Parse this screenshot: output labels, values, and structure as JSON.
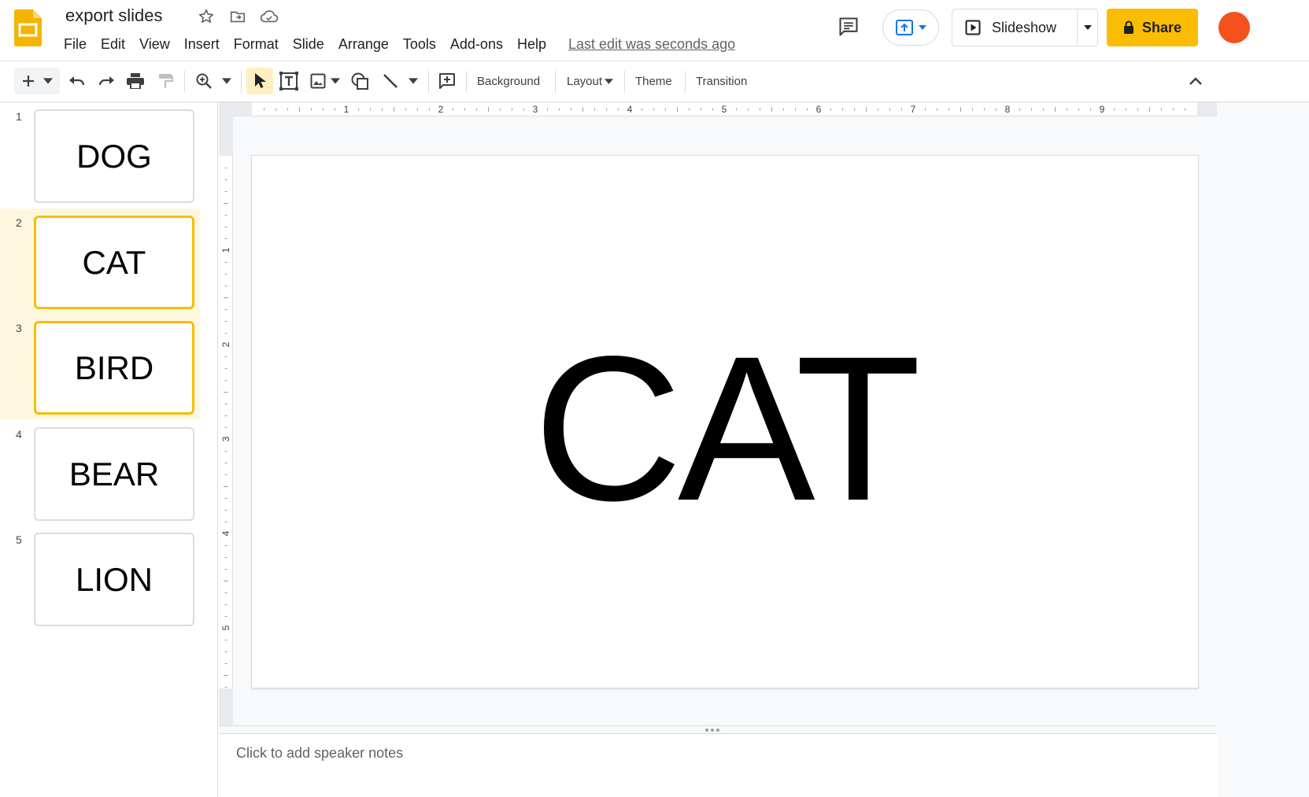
{
  "doc": {
    "title": "export slides",
    "last_edit": "Last edit was seconds ago"
  },
  "menu": [
    "File",
    "Edit",
    "View",
    "Insert",
    "Format",
    "Slide",
    "Arrange",
    "Tools",
    "Add-ons",
    "Help"
  ],
  "header_buttons": {
    "slideshow": "Slideshow",
    "share": "Share"
  },
  "toolbar": {
    "background": "Background",
    "layout": "Layout",
    "theme": "Theme",
    "transition": "Transition"
  },
  "ruler": {
    "horizontal_labels": [
      "1",
      "2",
      "3",
      "4",
      "5",
      "6",
      "7",
      "8",
      "9"
    ],
    "vertical_labels": [
      "1",
      "2",
      "3",
      "4",
      "5"
    ]
  },
  "slides": [
    {
      "number": "1",
      "text": "DOG",
      "selected": false
    },
    {
      "number": "2",
      "text": "CAT",
      "selected": true
    },
    {
      "number": "3",
      "text": "BIRD",
      "selected": true
    },
    {
      "number": "4",
      "text": "BEAR",
      "selected": false
    },
    {
      "number": "5",
      "text": "LION",
      "selected": false
    }
  ],
  "current_slide": {
    "text": "CAT"
  },
  "notes": {
    "placeholder": "Click to add speaker notes"
  },
  "colors": {
    "accent": "#fbbc04",
    "selection_bg": "#fef7e0",
    "logo": "#f4b400",
    "present_blue": "#1a73e8",
    "avatar": "#f4511e"
  },
  "icons": {
    "title": [
      "star-icon",
      "move-to-folder-icon",
      "cloud-saved-icon"
    ],
    "header": [
      "comment-icon",
      "present-icon",
      "slideshow-play-icon",
      "lock-icon"
    ],
    "toolbar": [
      "plus-icon",
      "undo-icon",
      "redo-icon",
      "print-icon",
      "paint-format-icon",
      "zoom-icon",
      "select-cursor-icon",
      "text-box-icon",
      "image-icon",
      "shape-icon",
      "line-icon",
      "add-comment-icon",
      "collapse-chevron-icon"
    ]
  }
}
